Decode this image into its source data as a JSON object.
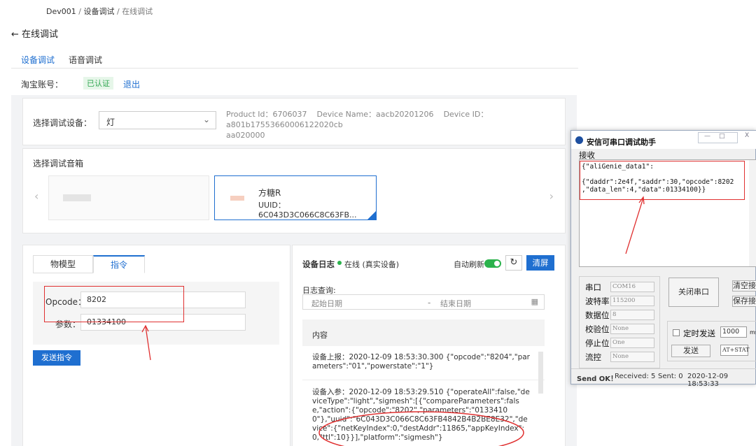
{
  "breadcrumb": {
    "root": "Dev001",
    "sep": "/",
    "level1": "设备调试",
    "level2": "在线调试"
  },
  "back": {
    "arrow": "←",
    "title": "在线调试"
  },
  "tabs": [
    "设备调试",
    "语音调试"
  ],
  "account": {
    "label": "淘宝账号：",
    "status": "已认证",
    "logout": "退出"
  },
  "device": {
    "label": "选择调试设备：",
    "selected": "灯",
    "product_id": "Product Id：6706037",
    "device_name": "Device Name：aacb20201206",
    "device_id": "Device ID：a801b17553660006122020cb",
    "device_id_cont": "aa020000"
  },
  "speaker": {
    "title": "选择调试音箱",
    "name": "方糖R",
    "uuid": "UUID：6C043D3C066C8C63FB..."
  },
  "left_panel": {
    "tabs": [
      "物模型",
      "指令"
    ],
    "opcode_label": "Opcode：",
    "opcode_value": "8202",
    "param_label": "参数：",
    "param_value": "01334100",
    "send_button": "发送指令"
  },
  "log": {
    "title": "设备日志",
    "status": "在线 (真实设备)",
    "auto_refresh": "自动刷新",
    "refresh_icon": "↻",
    "clear": "清屏",
    "query_label": "日志查询:",
    "start_date": "起始日期",
    "dash": "-",
    "end_date": "结束日期",
    "content_header": "内容",
    "entry1": "设备上报：2020-12-09 18:53:30.300 {\"opcode\":\"8204\",\"parameters\":\"01\",\"powerstate\":\"1\"}",
    "entry2": "设备入参：2020-12-09 18:53:29.510 {\"operateAll\":false,\"deviceType\":\"light\",\"sigmesh\":[{\"compareParameters\":false,\"action\":{\"opcode\":\"8202\",\"parameters\":\"01334100\"},\"uuid\":\"6C043D3C066C8C63FB4842B4B2BE8E32\",\"device\":{\"netKeyIndex\":0,\"destAddr\":11865,\"appKeyIndex\":0,\"ttl\":10}}],\"platform\":\"sigmesh\"}"
  },
  "serial": {
    "title": "安信可串口调试助手",
    "receive_label": "接收",
    "rx_line1": "{\"aliGenie_data1\":",
    "rx_line2": "{\"daddr\":2e4f,\"saddr\":30,\"opcode\":8202",
    "rx_line3": ",\"data_len\":4,\"data\":01334100}}",
    "port_label": "串口",
    "port_value": "COM16",
    "baud_label": "波特率",
    "baud_value": "115200",
    "data_bits_label": "数据位",
    "data_bits_value": "8",
    "parity_label": "校验位",
    "parity_value": "None",
    "stop_label": "停止位",
    "stop_value": "One",
    "flow_label": "流控",
    "flow_value": "None",
    "close_port": "关闭串口",
    "clear_btn": "清空接",
    "save_btn": "保存接",
    "timed_send": "定时发送",
    "interval": "1000",
    "interval_unit": "ms",
    "send": "发送",
    "send_text": "AT+STAT",
    "status_ok": "Send OK！",
    "status_rx": "Received: 5",
    "status_tx": "Sent: 0",
    "status_time": "2020-12-09 18:53:33"
  }
}
